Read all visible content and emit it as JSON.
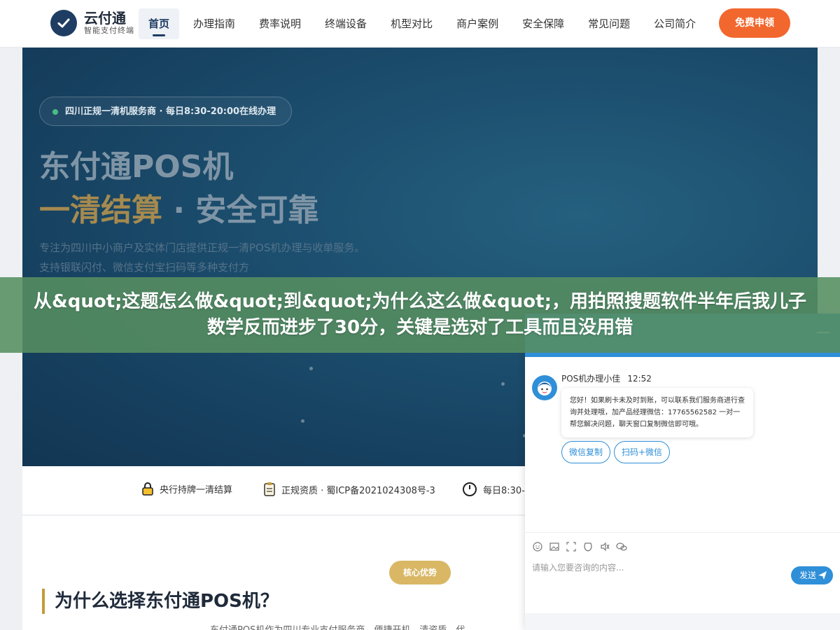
{
  "nav": {
    "logo_name": "云付通",
    "logo_sub": "智能支付终端",
    "items": [
      {
        "label": "首页",
        "active": true
      },
      {
        "label": "办理指南"
      },
      {
        "label": "费率说明"
      },
      {
        "label": "终端设备"
      },
      {
        "label": "机型对比"
      },
      {
        "label": "商户案例"
      },
      {
        "label": "安全保障"
      },
      {
        "label": "常见问题"
      },
      {
        "label": "公司简介"
      }
    ],
    "cta_label": "免费申领"
  },
  "hero": {
    "pill": "四川正规一清机服务商 · 每日8:30-20:00在线办理",
    "title_line1": "东付通POS机",
    "title_line2_gold": "一清结算",
    "title_line2_sep": " · ",
    "title_line2_rest": "安全可靠",
    "desc": "专注为四川中小商户及实体门店提供正规一清POS机办理与收单服务。支持银联闪付、微信支付宝扫码等多种支付方"
  },
  "banner": {
    "text": "从&quot;这题怎么做&quot;到&quot;为什么这么做&quot;，用拍照搜题软件半年后我儿子数学反而进步了30分，关键是选对了工具而且没用错"
  },
  "features": [
    {
      "icon": "lock-icon",
      "label": "央行持牌一清结算"
    },
    {
      "icon": "clipboard-icon",
      "label": "正规资质 · 蜀ICP备2021024308号-3"
    },
    {
      "icon": "clock-icon",
      "label": "每日8:30-"
    }
  ],
  "section": {
    "tag": "核心优势",
    "title": "为什么选择东付通POS机？",
    "body": "东付通POS机作为四川专业支付服务商，便捷开机，清资质，代"
  },
  "chat": {
    "agent_name": "POS机办理小佳",
    "time": "12:52",
    "message": "您好！如果刷卡未及时到账，可以联系我们服务商进行查询并处理哦，加产品经理微信：17765562582 一对一帮您解决问题，聊天窗口复制微信即可哦。",
    "quick_replies": [
      "微信复制",
      "扫码+微信"
    ],
    "input_placeholder": "请输入您要咨询的内容...",
    "send_label": "发送",
    "minimize_label": "—"
  },
  "colors": {
    "brand_navy": "#1f3d63",
    "cta_orange": "#f2672e",
    "chat_blue": "#2f8fd8",
    "gold": "#c49a3c",
    "banner_green": "#568e61"
  }
}
